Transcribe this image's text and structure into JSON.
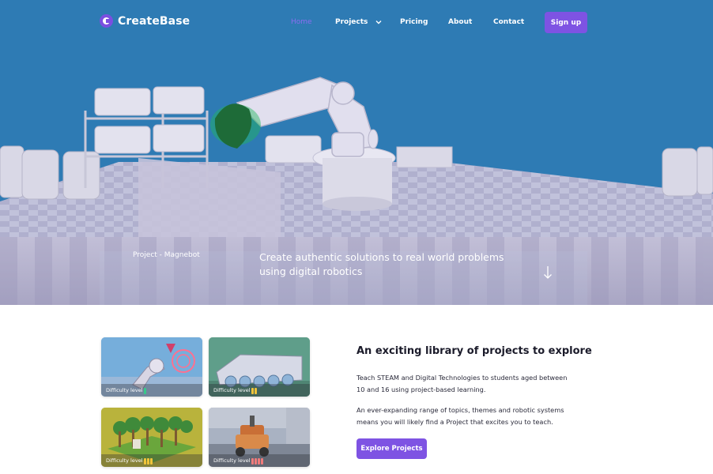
{
  "brand": {
    "name": "CreateBase",
    "icon": "createbase-logo-icon",
    "accent": "#7e53e3"
  },
  "nav": {
    "items": [
      {
        "label": "Home",
        "active": true
      },
      {
        "label": "Projects",
        "has_dropdown": true
      },
      {
        "label": "Pricing"
      },
      {
        "label": "About"
      },
      {
        "label": "Contact"
      }
    ],
    "signup_label": "Sign up"
  },
  "hero": {
    "project_tag": "Project - Magnebot",
    "tagline": "Create authentic solutions to real world problems using digital robotics",
    "scroll_icon": "arrow-down-icon",
    "background": "#2e7bb4"
  },
  "projects": {
    "title": "An exciting library of projects to explore",
    "paragraphs": [
      "Teach STEAM and Digital Technologies to students aged between 10 and 16 using project-based learning.",
      "An ever-expanding range of topics, themes and robotic systems means you will likely find a Project that excites you to teach."
    ],
    "cta_label": "Explore Projects",
    "cards": [
      {
        "difficulty_label": "Difficulty level",
        "difficulty": 1,
        "bar_color": "#37c98a"
      },
      {
        "difficulty_label": "Difficulty level",
        "difficulty": 2,
        "bar_color": "#f0c43a"
      },
      {
        "difficulty_label": "Difficulty level",
        "difficulty": 3,
        "bar_color": "#f0c43a"
      },
      {
        "difficulty_label": "Difficulty level",
        "difficulty": 4,
        "bar_color": "#f07a7a"
      }
    ]
  }
}
